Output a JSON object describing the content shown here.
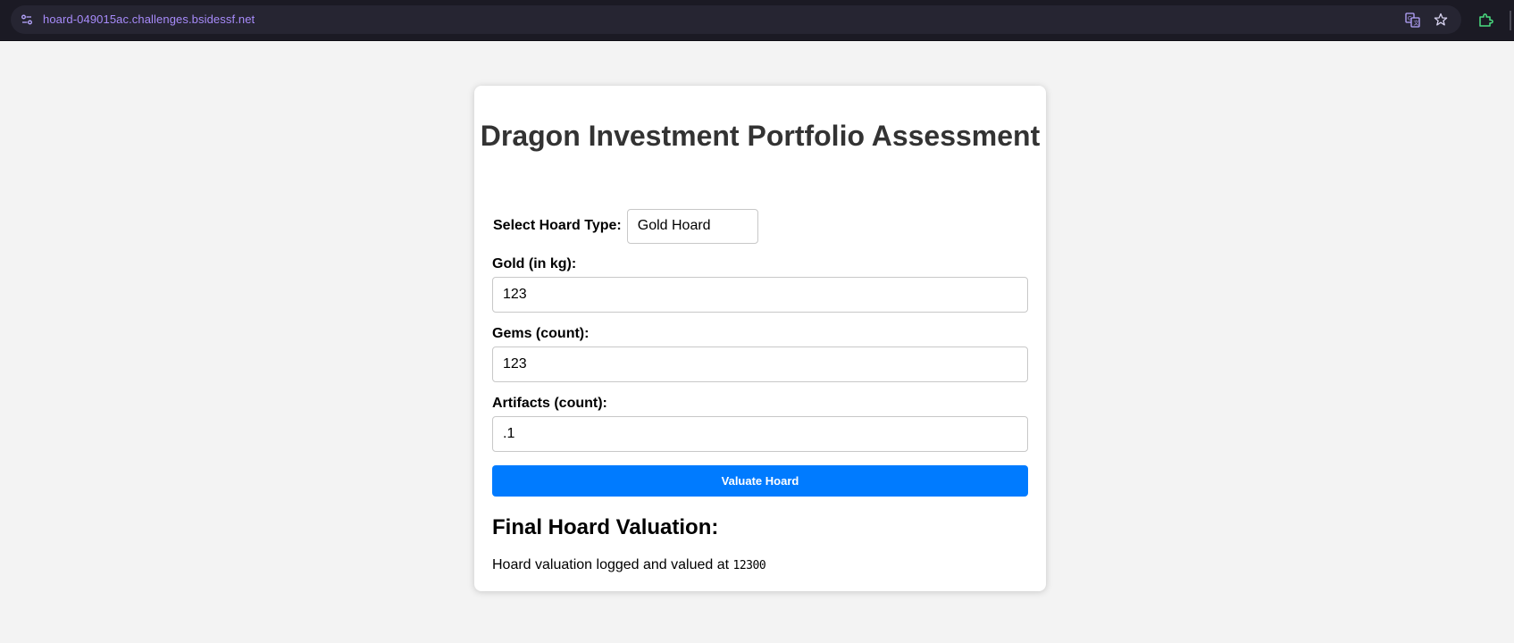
{
  "browser": {
    "url": "hoard-049015ac.challenges.bsidessf.net",
    "icons": [
      "site-info-icon",
      "translate-icon",
      "bookmark-star-icon",
      "extension-icon"
    ]
  },
  "page": {
    "title": "Dragon Investment Portfolio Assessment",
    "hoard_type": {
      "label": "Select Hoard Type:",
      "selected": "Gold Hoard"
    },
    "fields": [
      {
        "label": "Gold (in kg):",
        "value": "123"
      },
      {
        "label": "Gems (count):",
        "value": "123"
      },
      {
        "label": "Artifacts (count):",
        "value": ".1"
      }
    ],
    "submit_label": "Valuate Hoard",
    "result": {
      "heading": "Final Hoard Valuation:",
      "prefix": "Hoard valuation logged and valued at ",
      "value": "12300"
    }
  },
  "colors": {
    "page_bg": "#f3f3f3",
    "browser_bar": "#1b1a24",
    "url_text": "#a78bfa",
    "title_text": "#333333",
    "button_bg": "#007bff",
    "extension_icon": "#4ade80"
  }
}
